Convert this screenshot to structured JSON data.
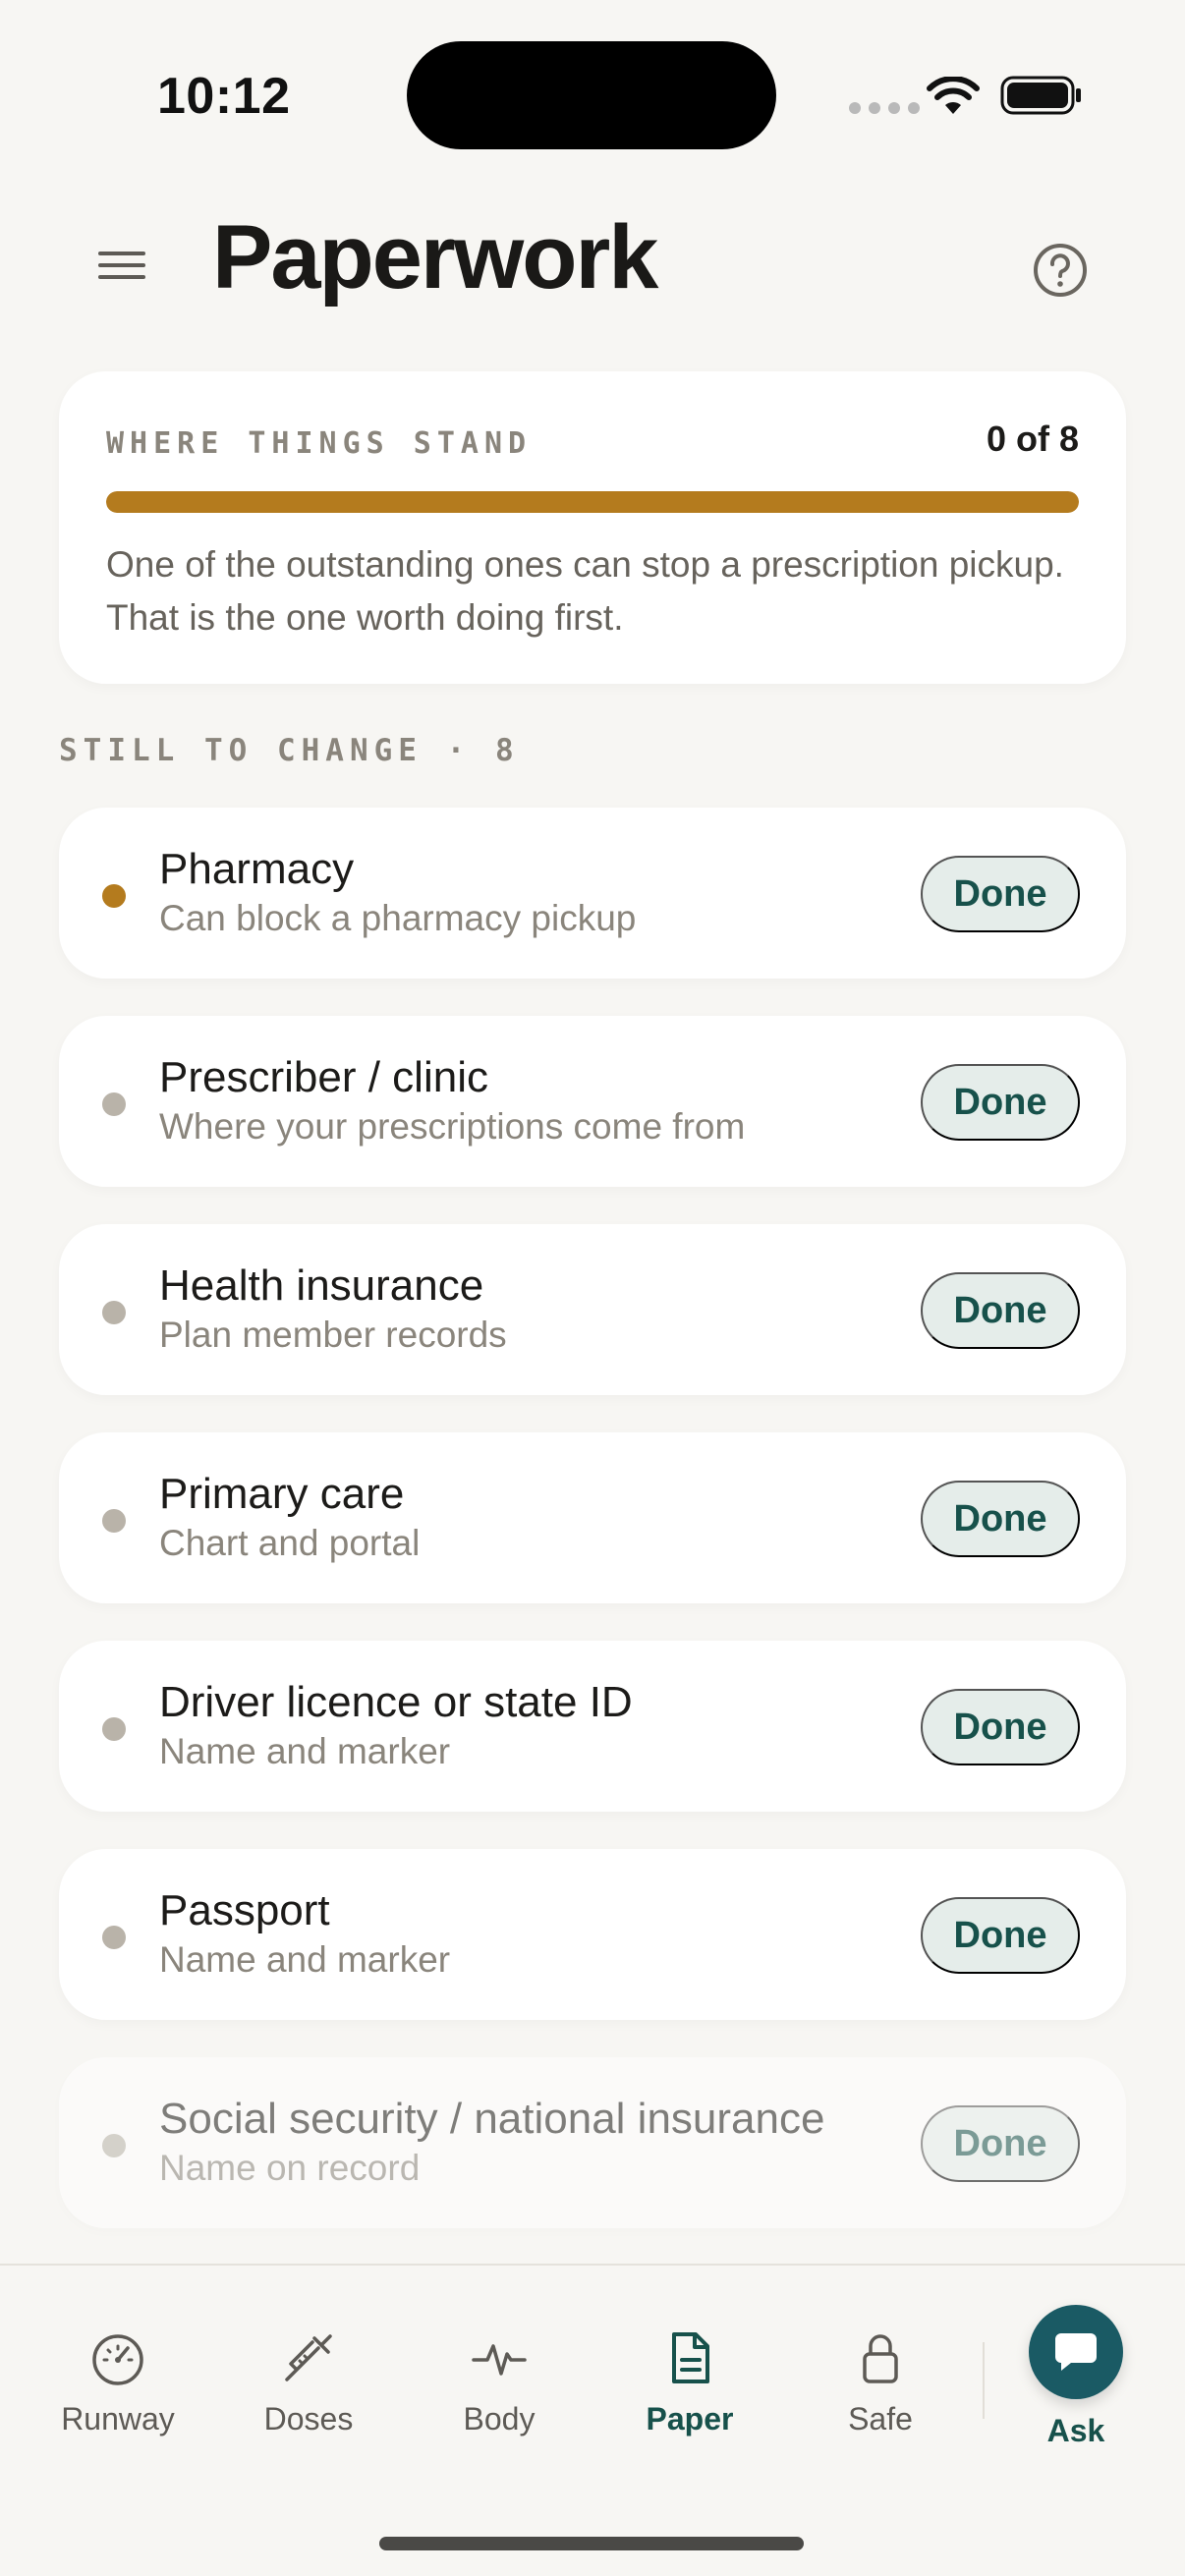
{
  "status_bar": {
    "time": "10:12"
  },
  "header": {
    "title": "Paperwork",
    "menu_icon": "hamburger-icon",
    "help_icon": "question-circle-icon"
  },
  "summary": {
    "label": "WHERE THINGS STAND",
    "count": "0 of 8",
    "progress": {
      "completed": 0,
      "total": 8
    },
    "text": "One of the outstanding ones can stop a prescription pickup. That is the one worth doing first.",
    "accent_color": "#b47b1e"
  },
  "section": {
    "label": "STILL TO CHANGE · 8"
  },
  "tasks": [
    {
      "title": "Pharmacy",
      "subtitle": "Can block a pharmacy pickup",
      "action": "Done",
      "urgent": true
    },
    {
      "title": "Prescriber / clinic",
      "subtitle": "Where your prescriptions come from",
      "action": "Done",
      "urgent": false
    },
    {
      "title": "Health insurance",
      "subtitle": "Plan member records",
      "action": "Done",
      "urgent": false
    },
    {
      "title": "Primary care",
      "subtitle": "Chart and portal",
      "action": "Done",
      "urgent": false
    },
    {
      "title": "Driver licence or state ID",
      "subtitle": "Name and marker",
      "action": "Done",
      "urgent": false
    },
    {
      "title": "Passport",
      "subtitle": "Name and marker",
      "action": "Done",
      "urgent": false
    },
    {
      "title": "Social security / national insurance",
      "subtitle": "Name on record",
      "action": "Done",
      "urgent": false
    }
  ],
  "nav": {
    "items": [
      {
        "label": "Runway",
        "icon": "gauge-icon"
      },
      {
        "label": "Doses",
        "icon": "syringe-icon"
      },
      {
        "label": "Body",
        "icon": "pulse-icon"
      },
      {
        "label": "Paper",
        "icon": "document-icon",
        "active": true
      },
      {
        "label": "Safe",
        "icon": "lock-icon"
      }
    ],
    "ask": {
      "label": "Ask",
      "icon": "chat-bubble-icon"
    },
    "active_color": "#17514b"
  }
}
